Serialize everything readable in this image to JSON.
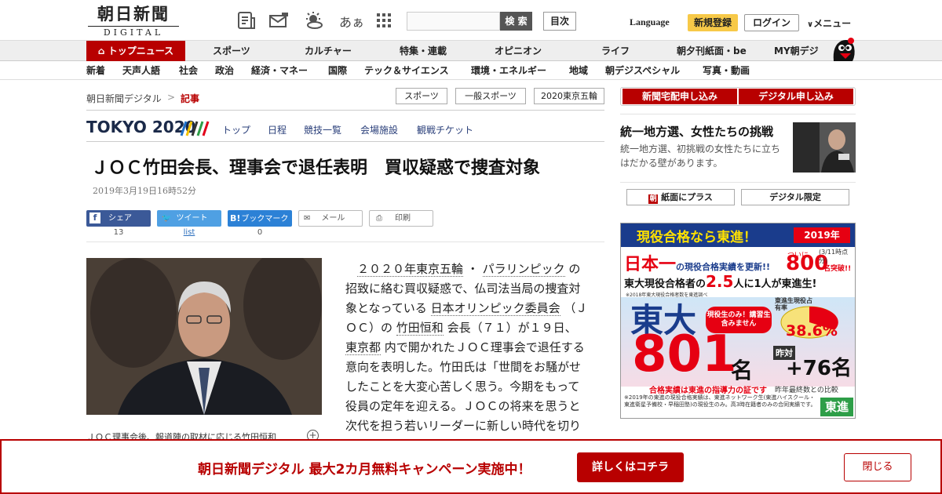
{
  "header": {
    "logo_jp": "朝日新聞",
    "logo_en": "DIGITAL",
    "icons": [
      "newspaper-icon",
      "mail-icon",
      "weather-icon",
      "font-size-icon",
      "apps-grid-icon"
    ],
    "font_icon_label": "あぁ",
    "search_placeholder": "",
    "search_button": "検 索",
    "toc_button": "目次",
    "language": "Language",
    "register": "新規登録",
    "login": "ログイン",
    "menu": "メニュー"
  },
  "nav_primary": [
    "トップニュース",
    "スポーツ",
    "カルチャー",
    "特集・連載",
    "オピニオン",
    "ライフ",
    "朝夕刊紙面・be",
    "MY朝デジ"
  ],
  "nav_secondary": [
    "新着",
    "天声人語",
    "社会",
    "政治",
    "経済・マネー",
    "国際",
    "テック＆サイエンス",
    "環境・エネルギー",
    "地域",
    "朝デジスペシャル",
    "写真・動画"
  ],
  "breadcrumb": {
    "home": "朝日新聞デジタル",
    "sep": ">",
    "current": "記事"
  },
  "tags": [
    "スポーツ",
    "一般スポーツ",
    "2020東京五輪"
  ],
  "olympic": {
    "logo": "TOKYO 2020",
    "links": [
      "トップ",
      "日程",
      "競技一覧",
      "会場施設",
      "観戦チケット"
    ],
    "stripe_colors": [
      "#1e6fc8",
      "#f4c300",
      "#333333",
      "#2e9e48",
      "#e2001a"
    ]
  },
  "article": {
    "headline": "ＪＯＣ竹田会長、理事会で退任表明　買収疑惑で捜査対象",
    "date": "2019年3月19日16時52分",
    "share": {
      "facebook": "シェア",
      "facebook_count": "13",
      "twitter": "ツイート",
      "twitter_count": "list",
      "hatena": "ブックマーク",
      "hatena_count": "0",
      "mail": "メール",
      "print": "印刷"
    },
    "caption": "ＪＯＣ理事会後、報道陣の取材に応じる竹田恒和",
    "body": {
      "p1": "　",
      "l1": "２０２０年東京五輪",
      "t1": " ・ ",
      "l2": "パラリンピック",
      "t2": " の招致に絡む買収疑惑で、仏司法当局の捜査対象となっている ",
      "l3": "日本オリンピック委員会",
      "t3": " （ＪＯＣ）の ",
      "l4": "竹田恒和",
      "t4": " 会長（７１）が１９日、 ",
      "l5": "東京都",
      "t5": " 内で開かれたＪＯＣ理事会で退任する意向を表明した。竹田氏は「世間をお騒がせしたことを大変心苦しく思う。今期をもって役員の定年を迎える。ＪＯＣの将来を思うと次代を担う若いリーダーに新しい時代を切り開いてもらった方が"
    }
  },
  "sidebar": {
    "subscribe_paper": "新聞宅配申し込み",
    "subscribe_digital": "デジタル申し込み",
    "promo_title": "統一地方選、女性たちの挑戦",
    "promo_text": "統一地方選、初挑戦の女性たちに立ちはだかる壁があります。",
    "paper_plus": "紙面にプラス",
    "digital_only": "デジタル限定"
  },
  "ad": {
    "header": "現役合格なら東進！",
    "year": "2019年",
    "line1": "日本一の現役合格実績を更新!!",
    "ichi": "日本一",
    "update": "の現役合格実績を更新!!",
    "ni": "ついに",
    "count800": "800",
    "count800_suffix": "名突破!!",
    "asof": "(3/11時点分)",
    "line2a": "東大現役合格者の",
    "line2b": "2.5",
    "line2c": "人に1人が東進生!",
    "note1": "※2018年東大現役合格者数を東進調べ",
    "todai": "東大",
    "badge": "現役生のみ！講習生含みません",
    "pie_label": "東進生現役占有率",
    "pie_pct": "38.6%",
    "num801": "801",
    "mei": "名",
    "diff_label": "昨対",
    "diff": "+76名",
    "footer1": "合格実績は東進の指導力の証です",
    "footer2": "昨年最終数との比較",
    "fine": "※2019年の東進の現役合格実績は、東進ネットワーク生(東進ハイスクール・東進衛星予備校・早稲田塾)の現役生のみ。高3時在籍者のみの合同実績です。",
    "brand": "東進",
    "colors": {
      "red": "#e60012",
      "blue": "#1a3c8c",
      "yellow": "#ffe100"
    }
  },
  "banner": {
    "text": "朝日新聞デジタル 最大2カ月無料キャンペーン実施中！",
    "cta": "詳しくはコチラ",
    "close": "閉じる",
    "accent": "#b80000"
  }
}
